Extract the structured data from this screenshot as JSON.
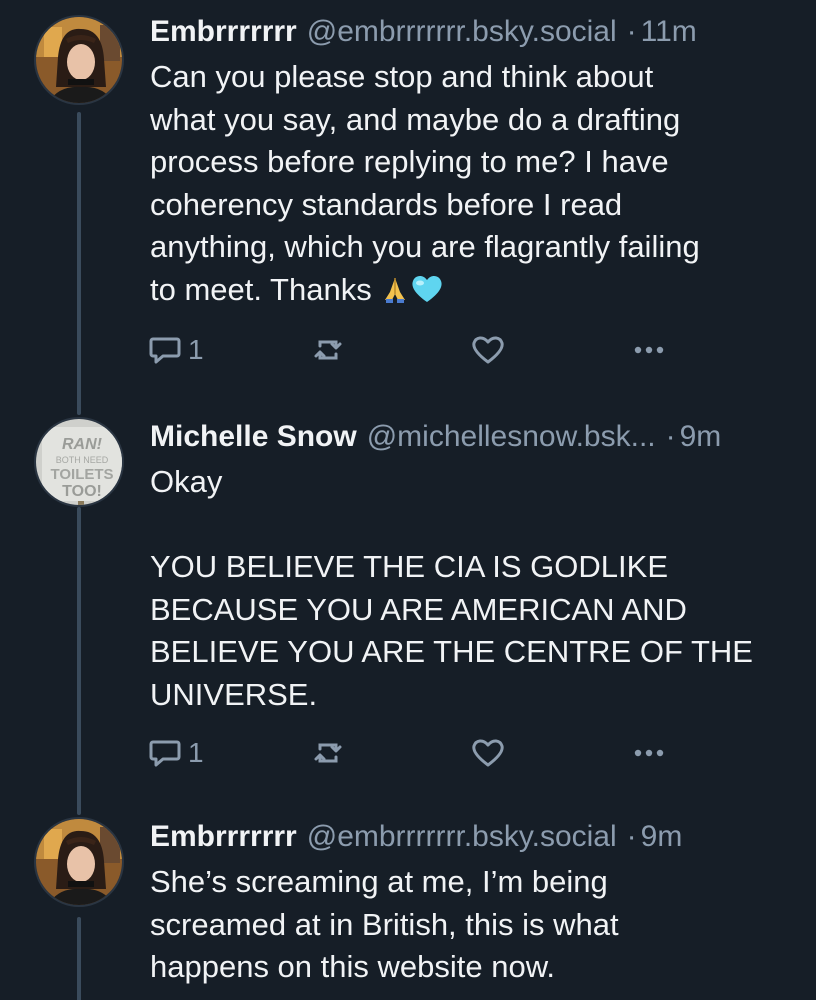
{
  "colors": {
    "background": "#161e27",
    "text": "#f1f3f5",
    "muted": "#8c9cae",
    "thread_line": "#3a4b5c"
  },
  "posts": [
    {
      "author_name": "Embrrrrrrr",
      "handle": "@embrrrrrrr.bsky.social",
      "separator": "·",
      "time": "11m",
      "text_main": "Can you please stop and think about\nwhat you say, and maybe do a drafting\nprocess before replying to me? I have\ncoherency standards before I read\nanything, which you are flagrantly failing\nto meet. Thanks ",
      "emojis": [
        "folded-hands-emoji",
        "light-blue-heart-emoji"
      ],
      "reply_count": "1",
      "avatar": "user-avatar-photo"
    },
    {
      "author_name": "Michelle Snow",
      "handle": "@michellesnow.bsk...",
      "separator": "·",
      "time": "9m",
      "text_main": "Okay\n\nYOU BELIEVE THE CIA IS GODLIKE\nBECAUSE YOU ARE AMERICAN AND\nBELIEVE YOU ARE THE CENTRE OF THE\nUNIVERSE.",
      "reply_count": "1",
      "avatar": "protest-sign-avatar"
    },
    {
      "author_name": "Embrrrrrrr",
      "handle": "@embrrrrrrr.bsky.social",
      "separator": "·",
      "time": "9m",
      "text_main": "She’s screaming at me, I’m being\nscreamed at in British, this is what\nhappens on this website now.",
      "avatar": "user-avatar-photo"
    }
  ]
}
